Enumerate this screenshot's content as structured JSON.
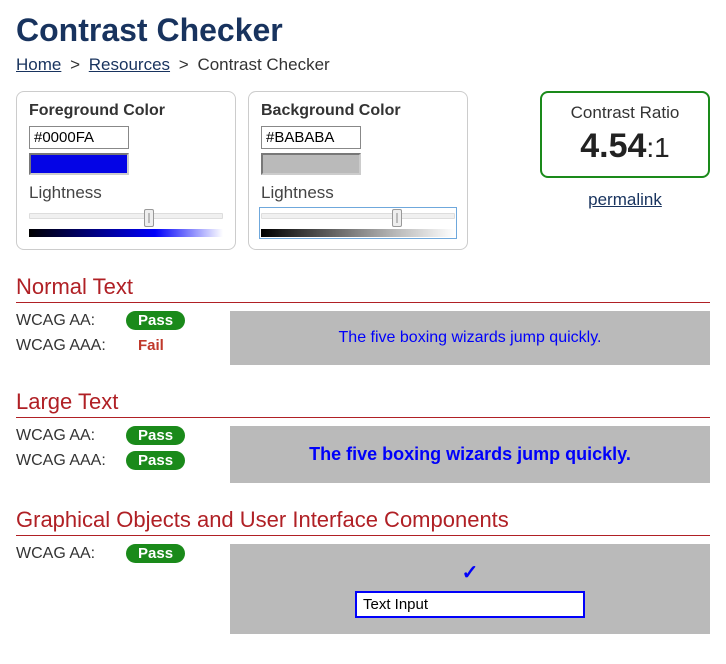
{
  "title": "Contrast Checker",
  "breadcrumb": {
    "home": "Home",
    "resources": "Resources",
    "current": "Contrast Checker",
    "sep": ">"
  },
  "fg": {
    "legend": "Foreground Color",
    "value": "#0000FA",
    "lightness_label": "Lightness",
    "thumb_pct": 62
  },
  "bg": {
    "legend": "Background Color",
    "value": "#BABABA",
    "lightness_label": "Lightness",
    "thumb_pct": 70
  },
  "ratio": {
    "title": "Contrast Ratio",
    "value": "4.54",
    "suffix": ":1",
    "permalink": "permalink"
  },
  "normal": {
    "heading": "Normal Text",
    "aa_label": "WCAG AA:",
    "aa_status": "Pass",
    "aaa_label": "WCAG AAA:",
    "aaa_status": "Fail",
    "sample": "The five boxing wizards jump quickly."
  },
  "large": {
    "heading": "Large Text",
    "aa_label": "WCAG AA:",
    "aa_status": "Pass",
    "aaa_label": "WCAG AAA:",
    "aaa_status": "Pass",
    "sample": "The five boxing wizards jump quickly."
  },
  "ui": {
    "heading": "Graphical Objects and User Interface Components",
    "aa_label": "WCAG AA:",
    "aa_status": "Pass",
    "input_value": "Text Input"
  }
}
